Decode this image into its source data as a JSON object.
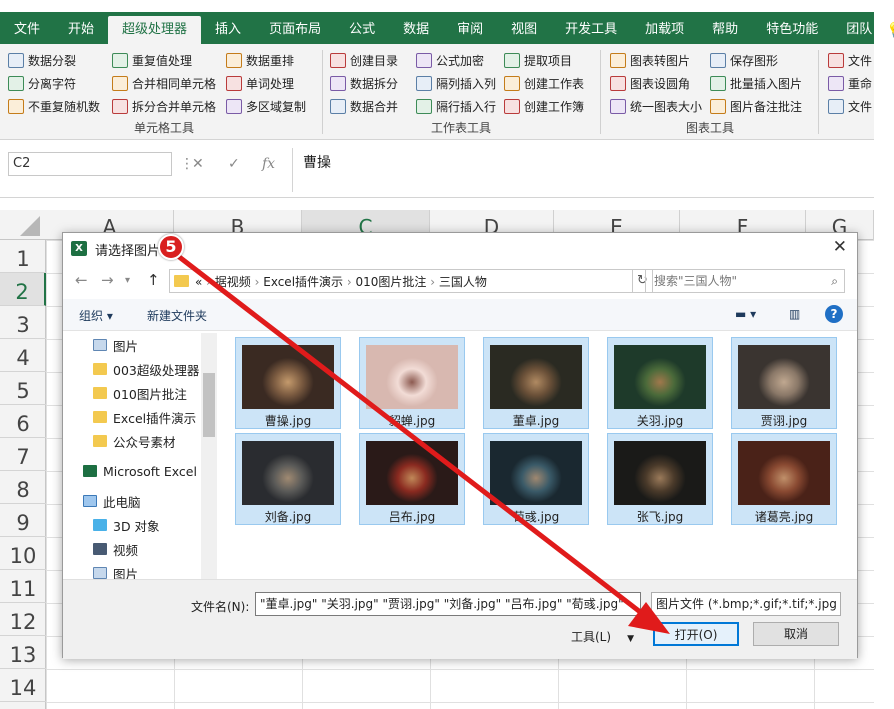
{
  "ribbon_tabs": [
    "文件",
    "开始",
    "超级处理器",
    "插入",
    "页面布局",
    "公式",
    "数据",
    "审阅",
    "视图",
    "开发工具",
    "加载项",
    "帮助",
    "特色功能",
    "团队"
  ],
  "ribbon": {
    "group1": {
      "label": "单元格工具",
      "col1": [
        "数据分裂",
        "分离字符",
        "不重复随机数"
      ],
      "col2": [
        "重复值处理",
        "合并相同单元格",
        "拆分合并单元格"
      ],
      "col3": [
        "数据重排",
        "单词处理",
        "多区域复制"
      ]
    },
    "group2": {
      "label": "工作表工具",
      "col1": [
        "创建目录",
        "数据拆分",
        "数据合并"
      ],
      "col2": [
        "公式加密",
        "隔列插入列",
        "隔行插入行"
      ],
      "col3": [
        "提取项目",
        "创建工作表",
        "创建工作簿"
      ]
    },
    "group3": {
      "label": "图表工具",
      "col1": [
        "图表转图片",
        "图表设圆角",
        "统一图表大小"
      ],
      "col2": [
        "保存图形",
        "批量插入图片",
        "图片备注批注"
      ]
    },
    "group4": {
      "col1": [
        "文件",
        "重命",
        "文件"
      ]
    }
  },
  "formula_bar": {
    "cell_ref": "C2",
    "value": "曹操",
    "fx_label": "fx"
  },
  "sheet": {
    "columns": [
      "A",
      "B",
      "C",
      "D",
      "E",
      "F",
      "G"
    ],
    "rows": [
      "1",
      "2",
      "3",
      "4",
      "5",
      "6",
      "7",
      "8",
      "9",
      "10",
      "11",
      "12",
      "13",
      "14"
    ]
  },
  "dialog": {
    "title": "请选择图片",
    "breadcrumb": [
      "«",
      "据视频",
      "Excel插件演示",
      "010图片批注",
      "三国人物"
    ],
    "search_placeholder": "搜索\"三国人物\"",
    "toolbar": {
      "organize": "组织 ▾",
      "new_folder": "新建文件夹"
    },
    "nav_items": [
      {
        "label": "图片",
        "icon": "pic"
      },
      {
        "label": "003超级处理器",
        "icon": "fold"
      },
      {
        "label": "010图片批注",
        "icon": "fold"
      },
      {
        "label": "Excel插件演示",
        "icon": "fold"
      },
      {
        "label": "公众号素材",
        "icon": "fold"
      },
      {
        "label": "Microsoft Excel",
        "icon": "xls"
      },
      {
        "label": "此电脑",
        "icon": "pc"
      },
      {
        "label": "3D 对象",
        "icon": "cube"
      },
      {
        "label": "视频",
        "icon": "vid"
      },
      {
        "label": "图片",
        "icon": "pic"
      }
    ],
    "files": [
      {
        "name": "曹操.jpg",
        "colors": [
          "#3a2a22",
          "#7a5a40",
          "#c49a6c"
        ]
      },
      {
        "name": "貂蝉.jpg",
        "colors": [
          "#d8b8b0",
          "#f2dcd6",
          "#8c5a50"
        ]
      },
      {
        "name": "董卓.jpg",
        "colors": [
          "#2a2a22",
          "#6a5038",
          "#b08a62"
        ]
      },
      {
        "name": "关羽.jpg",
        "colors": [
          "#1e3a2a",
          "#4a6a3a",
          "#a0784c"
        ]
      },
      {
        "name": "贾诩.jpg",
        "colors": [
          "#3a3430",
          "#8a7868",
          "#c0a890"
        ]
      },
      {
        "name": "刘备.jpg",
        "colors": [
          "#2a2c30",
          "#5a5a58",
          "#a08a72"
        ]
      },
      {
        "name": "吕布.jpg",
        "colors": [
          "#2a1a18",
          "#8a2a20",
          "#c08858"
        ]
      },
      {
        "name": "荀彧.jpg",
        "colors": [
          "#1a2830",
          "#3a5a68",
          "#a08870"
        ]
      },
      {
        "name": "张飞.jpg",
        "colors": [
          "#1a1a18",
          "#4a3a2a",
          "#9a7a5a"
        ]
      },
      {
        "name": "诸葛亮.jpg",
        "colors": [
          "#4a2218",
          "#8a4a32",
          "#c0906a"
        ]
      }
    ],
    "filename_label": "文件名(N):",
    "filename_value": "\"董卓.jpg\" \"关羽.jpg\" \"贾诩.jpg\" \"刘备.jpg\" \"吕布.jpg\" \"荀彧.jpg\"",
    "filetype_value": "图片文件 (*.bmp;*.gif;*.tif;*.jpg",
    "tools_label": "工具(L)",
    "open_label": "打开(O)",
    "cancel_label": "取消"
  },
  "annotation": {
    "step": "5",
    "color": "#e01b1b"
  }
}
